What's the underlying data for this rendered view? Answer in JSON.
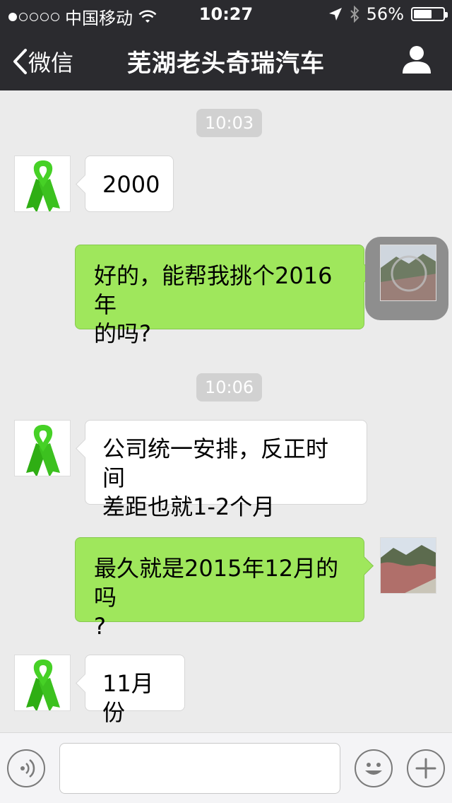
{
  "status_bar": {
    "carrier": "中国移动",
    "time": "10:27",
    "battery": "56%",
    "battery_level": 0.56,
    "signal_bars_filled": 1,
    "signal_bars_total": 5
  },
  "nav": {
    "back_label": "微信",
    "title": "芜湖老头奇瑞汽车"
  },
  "messages": [
    {
      "type": "timestamp",
      "text": "10:03"
    },
    {
      "type": "incoming",
      "text": "2000"
    },
    {
      "type": "outgoing",
      "lines": [
        "好的，能帮我挑个2016年",
        "的吗?"
      ]
    },
    {
      "type": "timestamp",
      "text": "10:06"
    },
    {
      "type": "incoming",
      "lines": [
        "公司统一安排，反正时间",
        "差距也就1-2个月"
      ]
    },
    {
      "type": "outgoing",
      "lines": [
        "最久就是2015年12月的吗",
        "?"
      ]
    },
    {
      "type": "incoming",
      "text": "11月份"
    }
  ],
  "colors": {
    "topbar": "#2b2b2f",
    "chat_background": "#ebebeb",
    "outgoing_bubble": "#9fe75c",
    "incoming_bubble": "#ffffff",
    "avatar_ribbon": "#3cc11f"
  },
  "icons": {
    "back": "chevron-left-icon",
    "profile": "person-icon",
    "voice": "voice-icon",
    "emoji": "smiley-icon",
    "more": "plus-icon",
    "contact_avatar": "green-ribbon",
    "self_avatar": "landscape-photo"
  }
}
